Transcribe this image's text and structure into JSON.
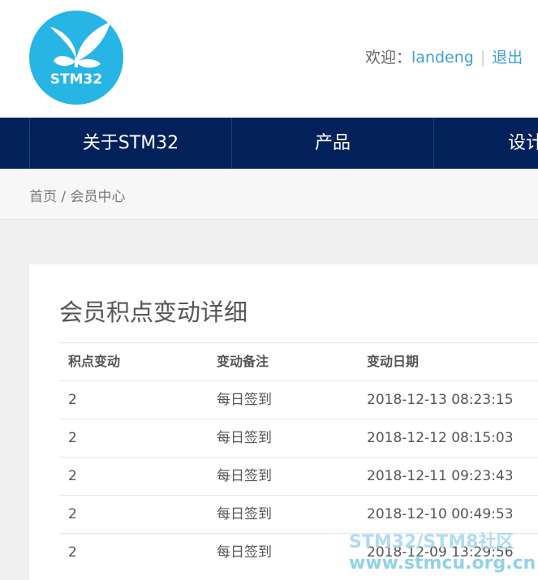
{
  "header": {
    "logo_text": "STM32",
    "welcome_label": "欢迎：",
    "username": "landeng",
    "separator": "|",
    "logout_label": "退出"
  },
  "nav": {
    "items": [
      {
        "label": "关于STM32"
      },
      {
        "label": "产品"
      },
      {
        "label": "设计资"
      }
    ]
  },
  "breadcrumb": {
    "home": "首页",
    "separator": " / ",
    "current": "会员中心"
  },
  "panel": {
    "title": "会员积点变动详细",
    "columns": [
      "积点变动",
      "变动备注",
      "变动日期"
    ],
    "rows": [
      {
        "points": "2",
        "note": "每日签到",
        "date": "2018-12-13 08:23:15"
      },
      {
        "points": "2",
        "note": "每日签到",
        "date": "2018-12-12 08:15:03"
      },
      {
        "points": "2",
        "note": "每日签到",
        "date": "2018-12-11 09:23:43"
      },
      {
        "points": "2",
        "note": "每日签到",
        "date": "2018-12-10 00:49:53"
      },
      {
        "points": "2",
        "note": "每日签到",
        "date": "2018-12-09 13:29:56"
      }
    ]
  },
  "watermark": {
    "line1": "STM32/STM8社区",
    "line2": "www.stmcu.org.cn"
  },
  "colors": {
    "nav_bg": "#02215a",
    "logo_bg": "#27b5e6",
    "link": "#3c9fd6"
  }
}
